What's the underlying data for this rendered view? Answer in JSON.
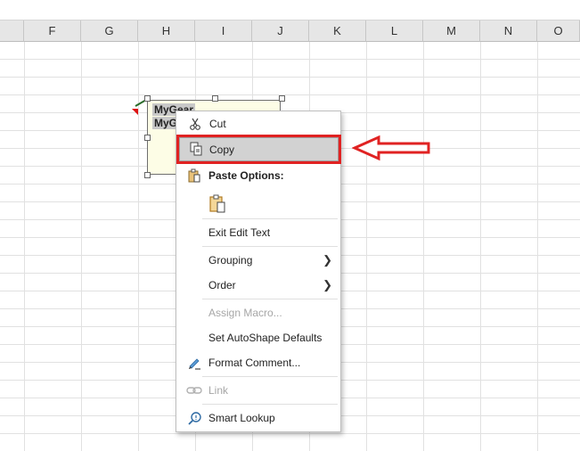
{
  "columns": [
    "F",
    "G",
    "H",
    "I",
    "J",
    "K",
    "L",
    "M",
    "N",
    "O"
  ],
  "comment": {
    "line1": "MyGear",
    "line2": "MyG"
  },
  "menu": {
    "cut": "Cut",
    "copy": "Copy",
    "paste_options": "Paste Options:",
    "exit_edit_text": "Exit Edit Text",
    "grouping": "Grouping",
    "order": "Order",
    "assign_macro": "Assign Macro...",
    "set_autoshape_defaults": "Set AutoShape Defaults",
    "format_comment": "Format Comment...",
    "link": "Link",
    "smart_lookup": "Smart Lookup"
  },
  "icons": {
    "cut": "scissors-icon",
    "copy": "copy-icon",
    "paste": "clipboard-icon",
    "format": "format-brush-icon",
    "link": "link-icon",
    "lookup": "search-icon"
  },
  "colors": {
    "highlight": "#e02222",
    "header_bg": "#e6e6e6"
  }
}
